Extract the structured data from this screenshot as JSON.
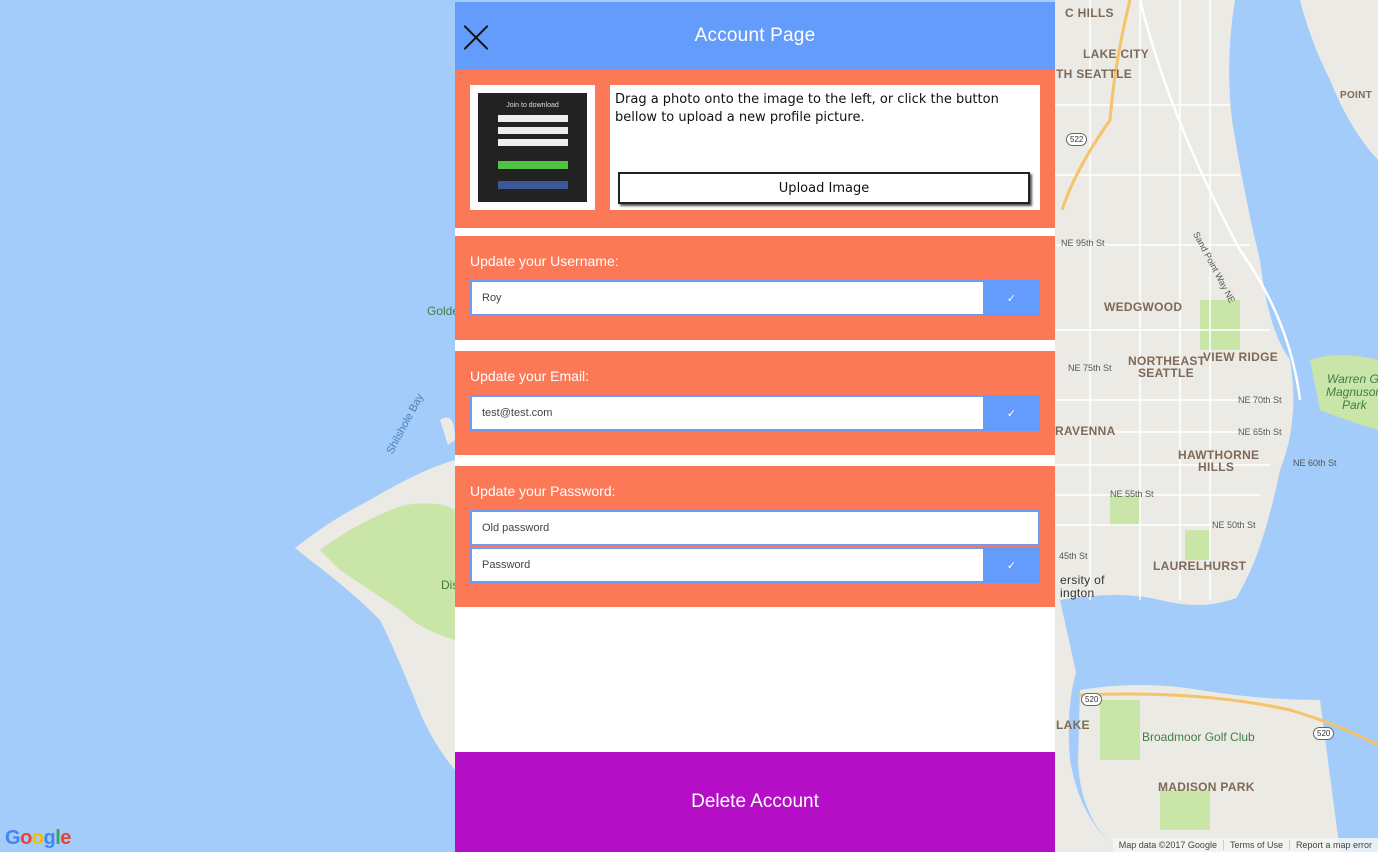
{
  "colors": {
    "header": "#649cfc",
    "section": "#fb7956",
    "accent_button": "#649cfc",
    "delete": "#b40ec7",
    "map_water": "#a3ccfa",
    "map_land": "#eceae4",
    "map_park": "#c9e5a8"
  },
  "header": {
    "title": "Account Page",
    "close_icon": "close-icon"
  },
  "photo": {
    "thumbnail": {
      "title": "Join to download"
    },
    "description": "Drag a photo onto the image to the left, or click the button bellow to upload a new profile picture.",
    "upload_label": "Upload Image"
  },
  "username": {
    "label": "Update your Username:",
    "value": "Roy",
    "confirm_icon": "✓"
  },
  "email": {
    "label": "Update your Email:",
    "value": "test@test.com",
    "confirm_icon": "✓"
  },
  "password": {
    "label": "Update your Password:",
    "old_placeholder": "Old password",
    "new_placeholder": "Password",
    "confirm_icon": "✓"
  },
  "delete_label": "Delete Account",
  "map": {
    "labels": {
      "hills": "C HILLS",
      "lake_city": "LAKE CITY",
      "north_seattle": "TH SEATTLE",
      "wedgwood": "WEDGWOOD",
      "northeast_seattle_1": "NORTHEAST",
      "northeast_seattle_2": "SEATTLE",
      "view_ridge": "VIEW RIDGE",
      "ravenna": "RAVENNA",
      "hawthorne_1": "HAWTHORNE",
      "hawthorne_2": "HILLS",
      "laurelhurst": "LAURELHURST",
      "university_1": "ersity of",
      "university_2": "ington",
      "lake": "LAKE",
      "madison_park": "MADISON PARK",
      "warren_1": "Warren G.",
      "warren_2": "Magnuson",
      "warren_3": "Park",
      "broadmoor": "Broadmoor Golf Club",
      "golden": "Golde",
      "discovery": "Dis",
      "shilshole": "Shilshole Bay",
      "point": "POINT",
      "ne95": "NE 95th St",
      "ne75": "NE 75th St",
      "ne70": "NE 70th St",
      "ne65": "NE 65th St",
      "ne60": "NE 60th St",
      "ne55": "NE 55th St",
      "ne50": "NE 50th St",
      "st45": "45th St",
      "sand_point": "Sand Point Way NE",
      "shield_522": "522",
      "shield_520a": "520",
      "shield_520b": "520"
    },
    "google": "Google",
    "footer": {
      "data": "Map data ©2017 Google",
      "terms": "Terms of Use",
      "report": "Report a map error"
    }
  }
}
